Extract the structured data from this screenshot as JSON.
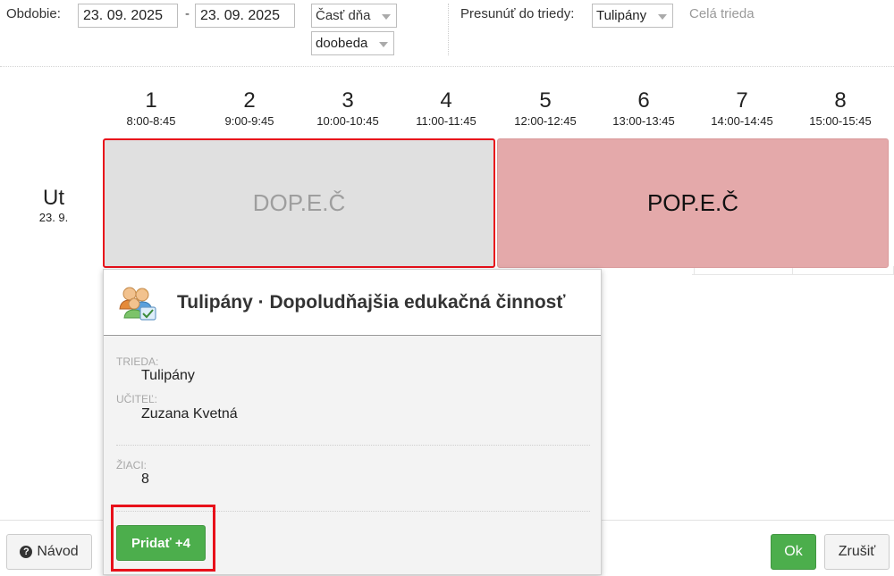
{
  "filters": {
    "period_label": "Obdobie:",
    "date_from": "23. 09. 2025",
    "date_separator": "-",
    "date_to": "23. 09. 2025",
    "part_of_day_placeholder": "Časť dňa",
    "part_of_day_value": "doobeda",
    "move_to_class_label": "Presunúť do triedy:",
    "move_to_class_value": "Tulipány",
    "whole_class_link": "Celá trieda"
  },
  "periods": [
    {
      "num": "1",
      "time": "8:00-8:45"
    },
    {
      "num": "2",
      "time": "9:00-9:45"
    },
    {
      "num": "3",
      "time": "10:00-10:45"
    },
    {
      "num": "4",
      "time": "11:00-11:45"
    },
    {
      "num": "5",
      "time": "12:00-12:45"
    },
    {
      "num": "6",
      "time": "13:00-13:45"
    },
    {
      "num": "7",
      "time": "14:00-14:45"
    },
    {
      "num": "8",
      "time": "15:00-15:45"
    }
  ],
  "day": {
    "name": "Ut",
    "date": "23. 9."
  },
  "blocks": {
    "morning": "DOP.E.Č",
    "afternoon": "POP.E.Č"
  },
  "popup": {
    "title": "Tulipány · Dopoludňajšia edukačná činnosť",
    "class_caption": "TRIEDA:",
    "class_value": "Tulipány",
    "teacher_caption": "UČITEĽ:",
    "teacher_value": "Zuzana Kvetná",
    "pupils_caption": "ŽIACI:",
    "pupils_value": "8",
    "add_button": "Pridať +4"
  },
  "footer": {
    "help_button": "Návod",
    "ok_button": "Ok",
    "cancel_button": "Zrušiť"
  },
  "colors": {
    "accent_green": "#4cae4c",
    "highlight_red": "#e8101a",
    "afternoon_block": "#e4a9aa",
    "morning_block": "#e0e0e0"
  },
  "icons": {
    "popup": "group-users-icon",
    "help": "question-circle-icon"
  }
}
